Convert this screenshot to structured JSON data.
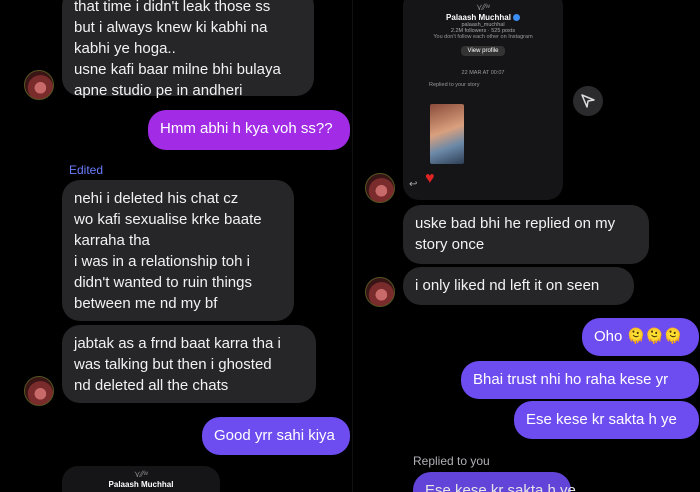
{
  "left": {
    "top_partial_text": "that time i didn't leak those ss",
    "msg1": [
      "but i always knew ki kabhi na",
      "kabhi ye hoga..",
      "usne kafi baar milne bhi bulaya",
      "apne studio pe in andheri"
    ],
    "out1": "Hmm abhi h kya voh ss??",
    "edited_label": "Edited",
    "msg2": [
      "nehi i deleted his chat cz",
      "wo kafi sexualise krke baate",
      "karraha tha",
      "i was in a relationship toh i",
      "didn't wanted to ruin things",
      "between me nd my bf"
    ],
    "msg3": [
      "jabtak as a frnd baat karra tha i",
      "was talking but then i ghosted",
      "nd deleted all the chats"
    ],
    "out2": "Good yrr sahi kiya",
    "card_name": "Palaash Muchhal"
  },
  "right": {
    "card": {
      "name": "Palaash Muchhal",
      "handle": "palaash_muchhal",
      "stats": "2.2M followers · 525 posts",
      "note": "You don't follow each other on Instagram",
      "button": "View profile",
      "date": "22 MAR AT 00:07",
      "replied_story": "Replied to your story"
    },
    "msg1": [
      "uske bad bhi he replied on my",
      "story once"
    ],
    "msg2": "i only liked nd left it on seen",
    "out1": "Oho 🫠🫠🫠",
    "out2": "Bhai trust nhi ho raha kese yr",
    "out3": "Ese kese kr sakta h ye",
    "replied_label": "Replied to you",
    "out4_partial": "Ese kese kr sakta h ye"
  },
  "colors": {
    "incoming": "#262628",
    "outgoing_purple": "#a22be6",
    "outgoing_violet": "#6d4cf0",
    "edited": "#6c7cff"
  },
  "icons": [
    "avatar",
    "send-icon",
    "reply-icon",
    "heart-icon",
    "verified-icon"
  ]
}
